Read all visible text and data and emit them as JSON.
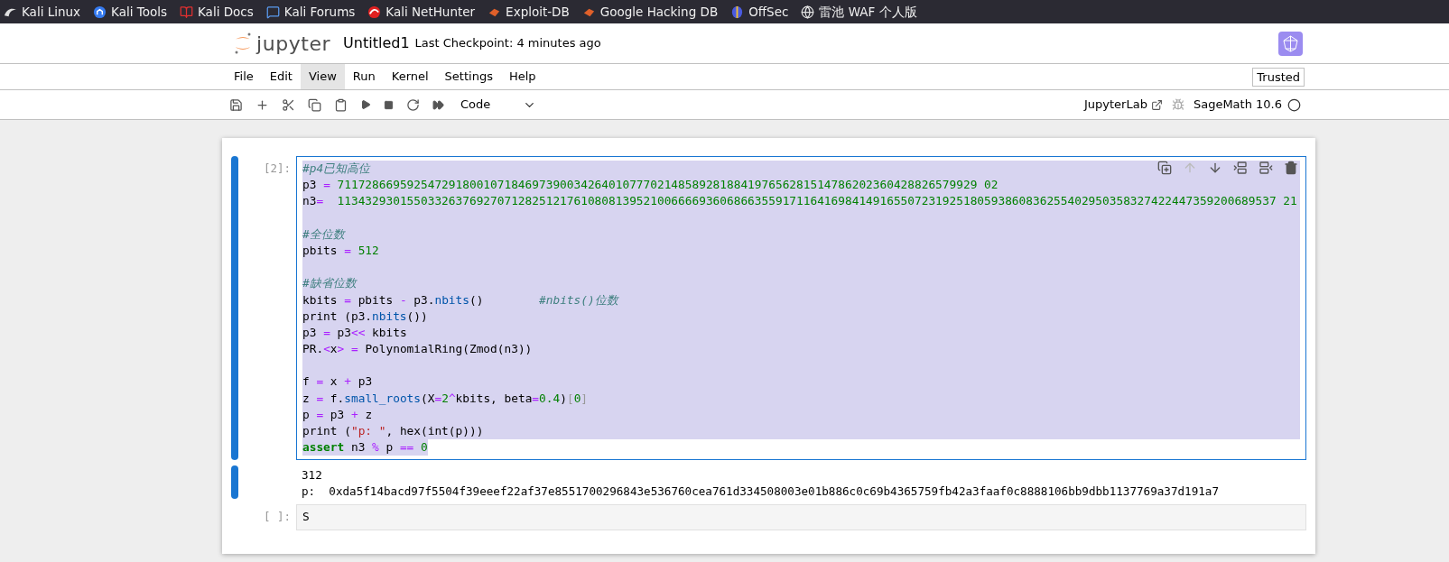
{
  "bookmarks": [
    "Kali Linux",
    "Kali Tools",
    "Kali Docs",
    "Kali Forums",
    "Kali NetHunter",
    "Exploit-DB",
    "Google Hacking DB",
    "OffSec",
    "雷池 WAF 个人版"
  ],
  "header": {
    "logo_text": "jupyter",
    "notebook_name": "Untitled1",
    "checkpoint": "Last Checkpoint: 4 minutes ago"
  },
  "menu": [
    {
      "label": "File",
      "selected": false
    },
    {
      "label": "Edit",
      "selected": false
    },
    {
      "label": "View",
      "selected": true
    },
    {
      "label": "Run",
      "selected": false
    },
    {
      "label": "Kernel",
      "selected": false
    },
    {
      "label": "Settings",
      "selected": false
    },
    {
      "label": "Help",
      "selected": false
    }
  ],
  "trusted": "Trusted",
  "toolbar": {
    "cell_type": "Code",
    "jupyterlab_link": "JupyterLab",
    "kernel": "SageMath 10.6"
  },
  "cells": [
    {
      "kind": "code",
      "prompt": "[2]:",
      "selected": true,
      "blocks": [
        [
          [
            {
              "kind": "comment",
              "text": "#p4已知高位"
            }
          ],
          [
            {
              "kind": "name",
              "text": "p3 "
            },
            {
              "kind": "op",
              "text": "= "
            },
            {
              "kind": "num",
              "text": "71172866959254729180010718469739003426401077702148589281884197656281514786202360428826579929 02"
            }
          ],
          [
            {
              "kind": "name",
              "text": "n3"
            },
            {
              "kind": "op",
              "text": "=  "
            },
            {
              "kind": "num",
              "text": "113432930155033263769270712825121761080813952100666693606866355917116416984149165507231925180593860836255402950358327422447359200689537 21"
            }
          ]
        ],
        [
          [
            {
              "kind": "comment",
              "text": "#全位数"
            }
          ],
          [
            {
              "kind": "name",
              "text": "pbits "
            },
            {
              "kind": "op",
              "text": "= "
            },
            {
              "kind": "num",
              "text": "512"
            }
          ]
        ],
        [
          [
            {
              "kind": "comment",
              "text": "#缺省位数"
            }
          ],
          [
            {
              "kind": "name",
              "text": "kbits "
            },
            {
              "kind": "op",
              "text": "="
            },
            {
              "kind": "name",
              "text": " pbits "
            },
            {
              "kind": "op",
              "text": "-"
            },
            {
              "kind": "name",
              "text": " p3."
            },
            {
              "kind": "func",
              "text": "nbits"
            },
            {
              "kind": "name",
              "text": "()        "
            },
            {
              "kind": "comment",
              "text": "#nbits()位数"
            }
          ],
          [
            {
              "kind": "name",
              "text": "print (p3."
            },
            {
              "kind": "func",
              "text": "nbits"
            },
            {
              "kind": "name",
              "text": "())"
            }
          ],
          [
            {
              "kind": "name",
              "text": "p3 "
            },
            {
              "kind": "op",
              "text": "="
            },
            {
              "kind": "name",
              "text": " p3"
            },
            {
              "kind": "op",
              "text": "<<"
            },
            {
              "kind": "name",
              "text": " kbits"
            }
          ],
          [
            {
              "kind": "name",
              "text": "PR."
            },
            {
              "kind": "op",
              "text": "<"
            },
            {
              "kind": "name",
              "text": "x"
            },
            {
              "kind": "op",
              "text": "> ="
            },
            {
              "kind": "name",
              "text": " PolynomialRing(Zmod(n3))"
            }
          ]
        ],
        [
          [
            {
              "kind": "name",
              "text": "f "
            },
            {
              "kind": "op",
              "text": "="
            },
            {
              "kind": "name",
              "text": " x "
            },
            {
              "kind": "op",
              "text": "+"
            },
            {
              "kind": "name",
              "text": " p3"
            }
          ],
          [
            {
              "kind": "name",
              "text": "z "
            },
            {
              "kind": "op",
              "text": "="
            },
            {
              "kind": "name",
              "text": " f."
            },
            {
              "kind": "func",
              "text": "small_roots"
            },
            {
              "kind": "name",
              "text": "(X"
            },
            {
              "kind": "op",
              "text": "="
            },
            {
              "kind": "num",
              "text": "2"
            },
            {
              "kind": "op",
              "text": "^"
            },
            {
              "kind": "name",
              "text": "kbits, beta"
            },
            {
              "kind": "op",
              "text": "="
            },
            {
              "kind": "num",
              "text": "0.4"
            },
            {
              "kind": "name",
              "text": ")"
            },
            {
              "kind": "punct",
              "text": "["
            },
            {
              "kind": "num",
              "text": "0"
            },
            {
              "kind": "punct",
              "text": "]"
            }
          ],
          [
            {
              "kind": "name",
              "text": "p "
            },
            {
              "kind": "op",
              "text": "="
            },
            {
              "kind": "name",
              "text": " p3 "
            },
            {
              "kind": "op",
              "text": "+"
            },
            {
              "kind": "name",
              "text": " z"
            }
          ],
          [
            {
              "kind": "name",
              "text": "print ("
            },
            {
              "kind": "str",
              "text": "\"p: \""
            },
            {
              "kind": "name",
              "text": ", hex(int(p)))"
            }
          ],
          [
            {
              "kind": "kw",
              "text": "assert"
            },
            {
              "kind": "name",
              "text": " n3 "
            },
            {
              "kind": "op",
              "text": "%"
            },
            {
              "kind": "name",
              "text": " p "
            },
            {
              "kind": "op",
              "text": "== "
            },
            {
              "kind": "num",
              "text": "0"
            }
          ]
        ]
      ],
      "output": [
        "312",
        "p:  0xda5f14bacd97f5504f39eeef22af37e8551700296843e536760cea761d334508003e01b886c0c69b4365759fb42a3faaf0c8888106bb9dbb1137769a37d191a7"
      ]
    },
    {
      "kind": "code",
      "prompt": "[ ]:",
      "selected": false,
      "blocks": [
        [
          [
            {
              "kind": "name",
              "text": "S"
            }
          ]
        ]
      ]
    }
  ]
}
